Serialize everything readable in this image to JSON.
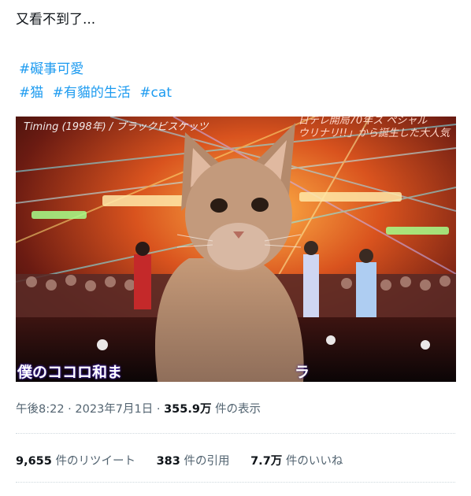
{
  "post": {
    "text": "又看不到了...",
    "hashtags_line1": [
      "#礙事可愛"
    ],
    "hashtags_line2": [
      "#猫",
      "#有貓的生活",
      "#cat"
    ]
  },
  "media": {
    "caption_top_left": "Timing (1998年) / ブラックビスケッツ",
    "caption_top_right_1": "日テレ開局70年ス ペシャル",
    "caption_top_right_2": "ウリナリ!!」から誕生した大人気",
    "caption_bottom_left": "僕のココロ和ま",
    "caption_bottom_right": "ラ"
  },
  "meta": {
    "time": "午後8:22",
    "date": "2023年7月1日",
    "separator": "·",
    "views_count": "355.9万",
    "views_label": "件の表示"
  },
  "stats": {
    "retweets_count": "9,655",
    "retweets_label": "件のリツイート",
    "quotes_count": "383",
    "quotes_label": "件の引用",
    "likes_count": "7.7万",
    "likes_label": "件のいいね"
  },
  "colors": {
    "hashtag": "#1d9bf0",
    "text": "#0f1419",
    "secondary": "#536471"
  }
}
